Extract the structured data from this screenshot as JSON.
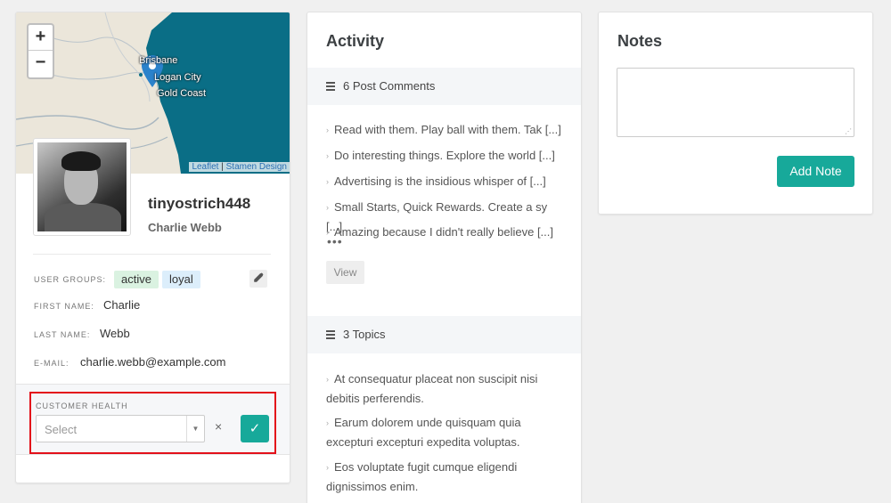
{
  "map": {
    "zoom_in": "+",
    "zoom_out": "−",
    "labels": [
      "Brisbane",
      "Logan City",
      "Gold Coast"
    ],
    "attribution_leaflet": "Leaflet",
    "attribution_sep": " | ",
    "attribution_stamen": "Stamen Design"
  },
  "profile": {
    "username": "tinyostrich448",
    "full_name": "Charlie Webb",
    "user_groups_label": "USER GROUPS:",
    "groups": [
      "active",
      "loyal"
    ],
    "first_name_label": "FIRST NAME:",
    "first_name": "Charlie",
    "last_name_label": "LAST NAME:",
    "last_name": "Webb",
    "email_label": "E-MAIL:",
    "email": "charlie.webb@example.com"
  },
  "health": {
    "label": "CUSTOMER HEALTH",
    "placeholder": "Select",
    "clear": "×",
    "confirm": "✓"
  },
  "activity": {
    "title": "Activity",
    "comments_header": "6 Post Comments",
    "comments": [
      "Read with them. Play ball with them. Tak [...]",
      "Do interesting things. Explore the world [...]",
      "Advertising is the insidious whisper of [...]",
      "Small Starts, Quick Rewards. Create a sy [...]",
      "Amazing because I didn't really believe [...]"
    ],
    "more": "•••",
    "view_button": "View",
    "topics_header": "3 Topics",
    "topics": [
      "At consequatur placeat non suscipit nisi debitis perferendis.",
      "Earum dolorem unde quisquam quia excepturi excepturi expedita voluptas.",
      "Eos voluptate fugit cumque eligendi dignissimos enim."
    ]
  },
  "notes": {
    "title": "Notes",
    "textarea_value": "",
    "add_button": "Add Note"
  },
  "colors": {
    "accent": "#17a99a",
    "highlight_border": "#e3101a",
    "sea": "#0a6e86",
    "tag_active": "#daf2e1",
    "tag_loyal": "#dceefb"
  }
}
